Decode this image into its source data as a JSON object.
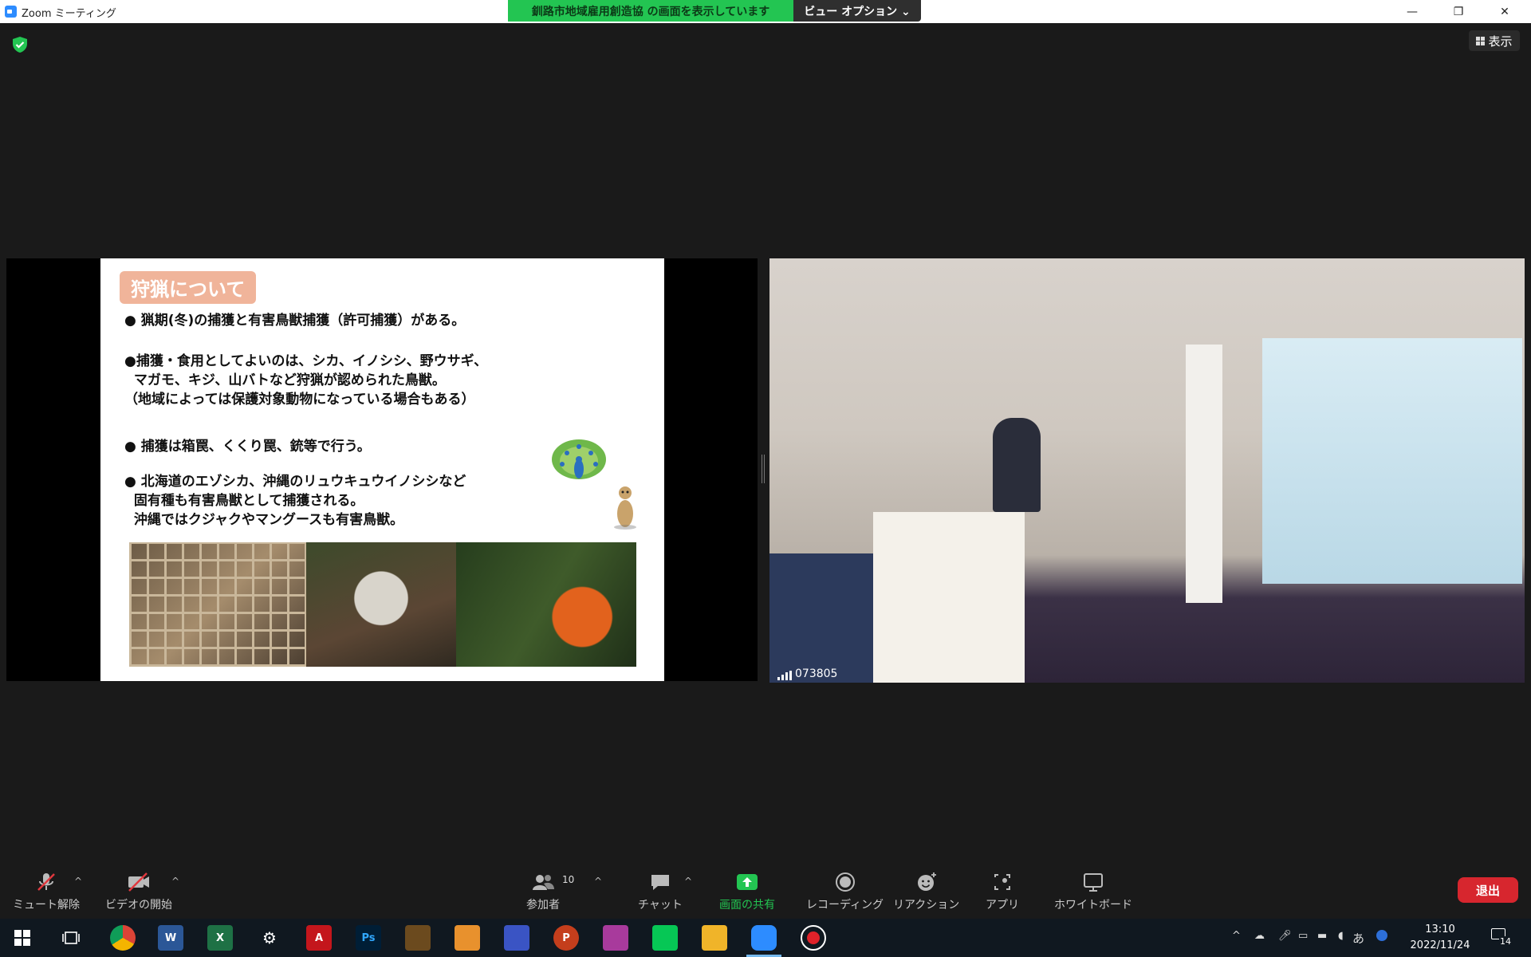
{
  "window": {
    "title": "Zoom ミーティング",
    "minimize": "—",
    "restore": "❐",
    "close": "✕"
  },
  "share_banner": {
    "text": "釧路市地域雇用創造協 の画面を表示しています",
    "view_options": "ビュー オプション ⌄"
  },
  "view_button": {
    "label": "表示"
  },
  "slide": {
    "title": "狩猟について",
    "bullet1": "● 猟期(冬)の捕獲と有害鳥獣捕獲（許可捕獲）がある。",
    "bullet2": "●捕獲・食用としてよいのは、シカ、イノシシ、野ウサギ、\n  マガモ、キジ、山バトなど狩猟が認められた鳥獣。\n（地域によっては保護対象動物になっている場合もある）",
    "bullet3": "● 捕獲は箱罠、くくり罠、銃等で行う。",
    "bullet4": "● 北海道のエゾシカ、沖縄のリュウキュウイノシシなど\n  固有種も有害鳥獣として捕獲される。\n  沖縄ではクジャクやマングースも有害鳥獣。"
  },
  "camera": {
    "participant_label": "073805"
  },
  "toolbar": {
    "mute": "ミュート解除",
    "video": "ビデオの開始",
    "participants": "参加者",
    "participants_count": "10",
    "chat": "チャット",
    "share": "画面の共有",
    "record": "レコーディング",
    "reaction": "リアクション",
    "apps": "アプリ",
    "whiteboard": "ホワイトボード",
    "leave": "退出"
  },
  "taskbar": {
    "time": "13:10",
    "date": "2022/11/24",
    "ime": "あ",
    "notifications": "14"
  },
  "colors": {
    "share_green": "#23c552",
    "leave_red": "#d7262e",
    "zoom_blue": "#2d8cff",
    "slide_title_bg": "#f0b49a"
  }
}
